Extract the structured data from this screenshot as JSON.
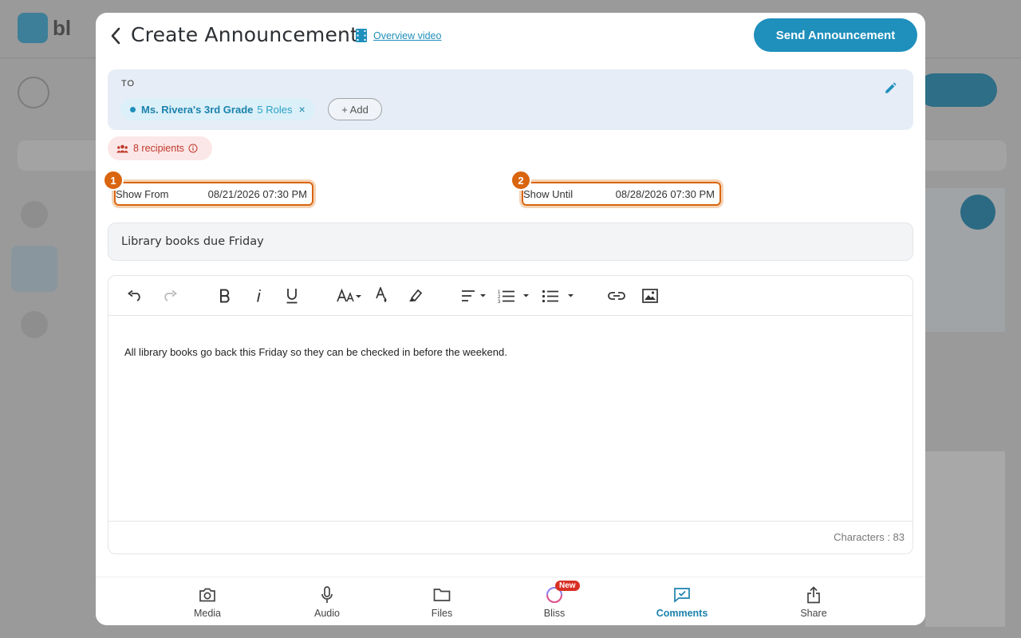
{
  "background": {
    "logo_text": "bl"
  },
  "modal": {
    "title": "Create Announcement",
    "overview_link": "Overview video",
    "send_button": "Send Announcement"
  },
  "to_section": {
    "label": "TO",
    "chip": {
      "name": "Ms. Rivera's 3rd Grade",
      "roles": "5 Roles",
      "close": "×"
    },
    "add_button": "+ Add"
  },
  "recipients": {
    "label": "8 recipients"
  },
  "schedule": {
    "show_from": {
      "badge": "1",
      "label": "Show From",
      "value": "08/21/2026  07:30 PM"
    },
    "show_until": {
      "badge": "2",
      "label": "Show Until",
      "value": "08/28/2026  07:30 PM"
    }
  },
  "subject": {
    "value": "Library books due Friday"
  },
  "editor": {
    "toolbar": [
      "undo-icon",
      "redo-icon",
      "bold-icon",
      "italic-icon",
      "underline-icon",
      "font-size-icon",
      "text-color-icon",
      "highlight-icon",
      "align-icon",
      "numbered-list-icon",
      "bullet-list-icon",
      "link-icon",
      "image-icon"
    ],
    "body": "All library books go back this Friday so they can be checked in before the weekend.",
    "char_count": "Characters : 83"
  },
  "bottom_bar": {
    "media": "Media",
    "audio": "Audio",
    "files": "Files",
    "bliss": "Bliss",
    "bliss_badge": "New",
    "comments": "Comments",
    "share": "Share"
  },
  "colors": {
    "accent": "#1f8fbc",
    "highlight": "#d9650f",
    "recipients": "#c0392b",
    "to_bg": "#e6edf6"
  }
}
